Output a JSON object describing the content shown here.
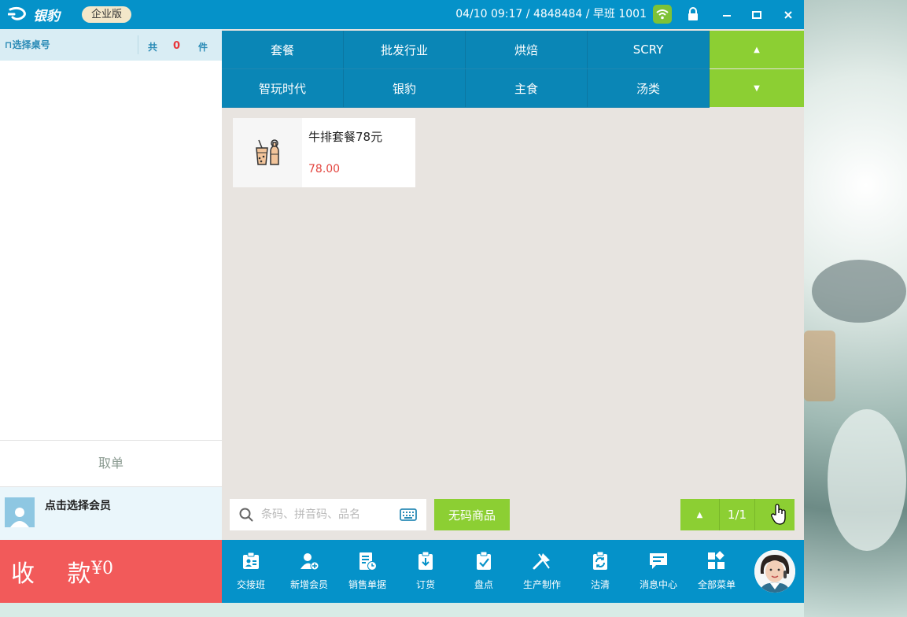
{
  "app": {
    "logo_text": "银豹",
    "edition": "企业版",
    "status_info": "04/10 09:17 / 4848484 / 早班 1001",
    "window_controls": [
      "minimize-icon",
      "maximize-icon",
      "close-icon"
    ]
  },
  "order": {
    "table_select_label": "选择桌号",
    "count_prefix": "共",
    "count_value": "0",
    "count_unit": "件",
    "pickup_label": "取单",
    "member_label": "点击选择会员",
    "pay_label": "收 款",
    "pay_amount": "¥0"
  },
  "categories": {
    "row1": [
      "套餐",
      "批发行业",
      "烘焙",
      "SCRY"
    ],
    "row2": [
      "智玩时代",
      "银豹",
      "主食",
      "汤类"
    ]
  },
  "products": [
    {
      "name": "牛排套餐78元",
      "price": "78.00",
      "icon": "drink-icon"
    }
  ],
  "search": {
    "placeholder": "条码、拼音码、品名",
    "value": "",
    "nocode_label": "无码商品"
  },
  "pager": {
    "page": "1/1"
  },
  "toolbar": {
    "items": [
      {
        "label": "交接班",
        "icon": "handover-icon"
      },
      {
        "label": "新增会员",
        "icon": "add-member-icon"
      },
      {
        "label": "销售单据",
        "icon": "sales-receipt-icon"
      },
      {
        "label": "订货",
        "icon": "order-goods-icon"
      },
      {
        "label": "盘点",
        "icon": "inventory-check-icon"
      },
      {
        "label": "生产制作",
        "icon": "production-icon"
      },
      {
        "label": "沽清",
        "icon": "sold-out-icon"
      },
      {
        "label": "消息中心",
        "icon": "message-icon"
      },
      {
        "label": "全部菜单",
        "icon": "all-menu-icon"
      }
    ]
  },
  "colors": {
    "titlebar": "#0592c9",
    "category": "#0a86b6",
    "accent_green": "#8ccf33",
    "pay_red": "#f25a5a",
    "price_red": "#e3443e"
  }
}
